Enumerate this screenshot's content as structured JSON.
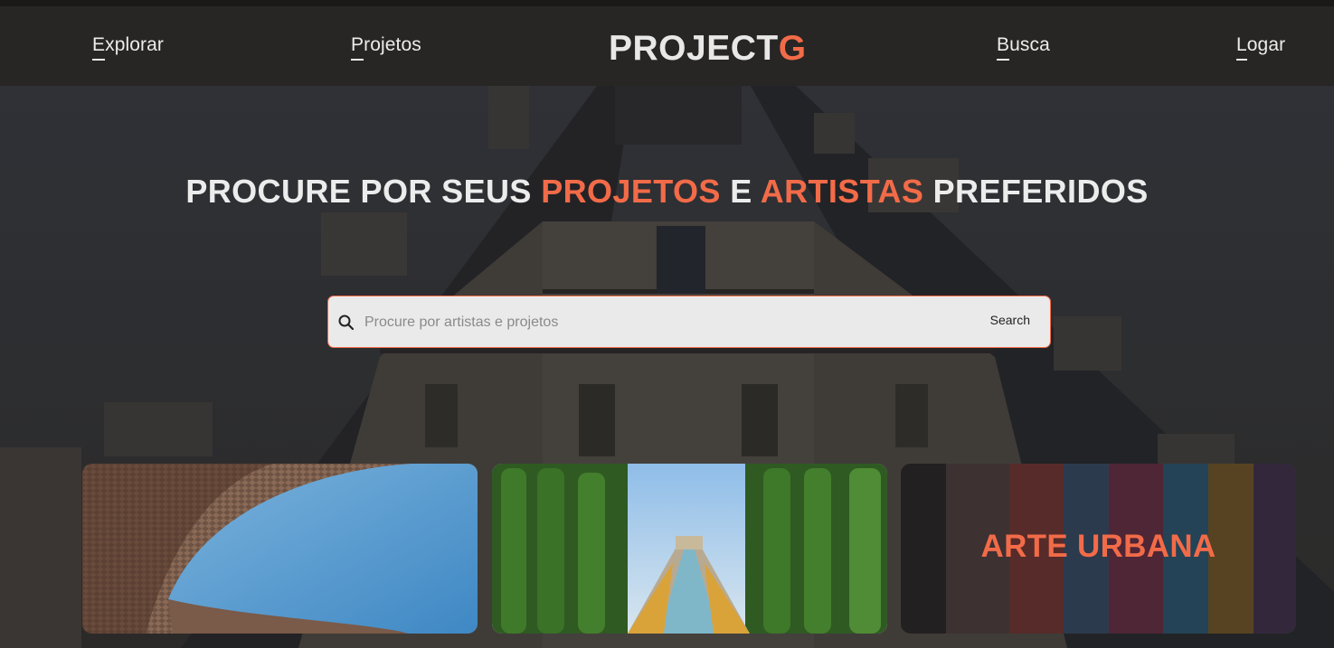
{
  "nav": {
    "links": [
      {
        "first": "E",
        "rest": "xplorar"
      },
      {
        "first": "P",
        "rest": "rojetos"
      },
      {
        "first": "B",
        "rest": "usca"
      },
      {
        "first": "L",
        "rest": "ogar"
      }
    ],
    "logo": {
      "main": "PROJECT",
      "accent": "G"
    }
  },
  "hero": {
    "headline": {
      "part1": "PROCURE POR SEUS ",
      "highlight1": "PROJETOS",
      "part2": " E ",
      "highlight2": "ARTISTAS",
      "part3": " PREFERIDOS"
    },
    "search": {
      "placeholder": "Procure por artistas e projetos",
      "button_label": "Search"
    }
  },
  "cards": [
    {
      "title": ""
    },
    {
      "title": ""
    },
    {
      "title": "ARTE URBANA"
    }
  ],
  "colors": {
    "accent": "#f26b48",
    "navbar": "#272624"
  }
}
